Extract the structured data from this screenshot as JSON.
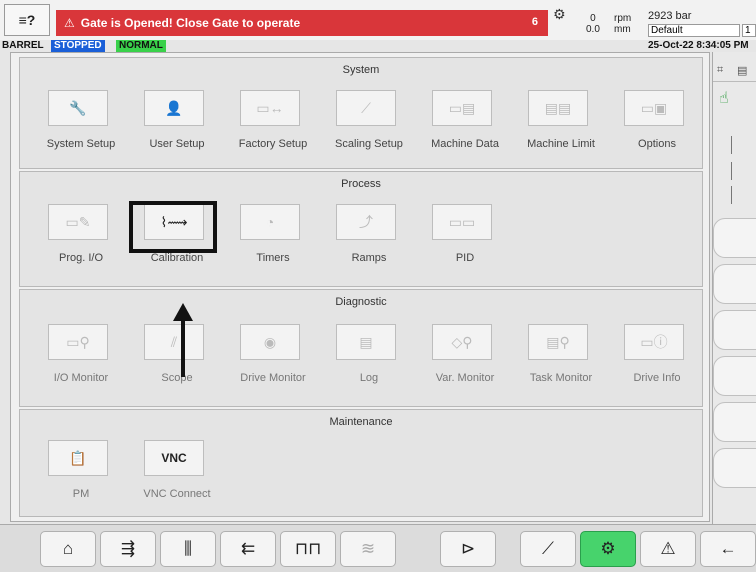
{
  "header": {
    "alarm_text": "Gate is Opened! Close Gate to operate",
    "alarm_count": "6",
    "speed_top": "0",
    "speed_bottom": "0.0",
    "unit_top": "rpm",
    "unit_bottom": "mm",
    "pressure": "2923 bar",
    "profile": "Default",
    "profile_extra": "1",
    "barrel": "BARREL",
    "state": "STOPPED",
    "mode": "NORMAL",
    "datetime": "25-Oct-22 8:34:05 PM"
  },
  "sections": {
    "system": {
      "title": "System",
      "items": [
        "System Setup",
        "User Setup",
        "Factory Setup",
        "Scaling Setup",
        "Machine Data",
        "Machine Limit",
        "Options"
      ]
    },
    "process": {
      "title": "Process",
      "items": [
        "Prog. I/O",
        "Calibration",
        "Timers",
        "Ramps",
        "PID"
      ]
    },
    "diagnostic": {
      "title": "Diagnostic",
      "items": [
        "I/O Monitor",
        "Scope",
        "Drive Monitor",
        "Log",
        "Var. Monitor",
        "Task Monitor",
        "Drive Info"
      ]
    },
    "maintenance": {
      "title": "Maintenance",
      "items": [
        "PM",
        "VNC Connect"
      ],
      "vnc_button": "VNC"
    }
  },
  "colors": {
    "alarm": "#d9363a",
    "stopped": "#1a5fd8",
    "normal": "#39d14a",
    "active_nav": "#47d36c"
  },
  "icons": {
    "system_setup": "wrench-icon",
    "user_setup": "user-icon",
    "calibration": "calibration-icon",
    "pm": "clipboard-icon",
    "home": "home-icon",
    "settings": "gear-icon",
    "alarm": "warning-icon",
    "back": "back-arrow-icon"
  }
}
